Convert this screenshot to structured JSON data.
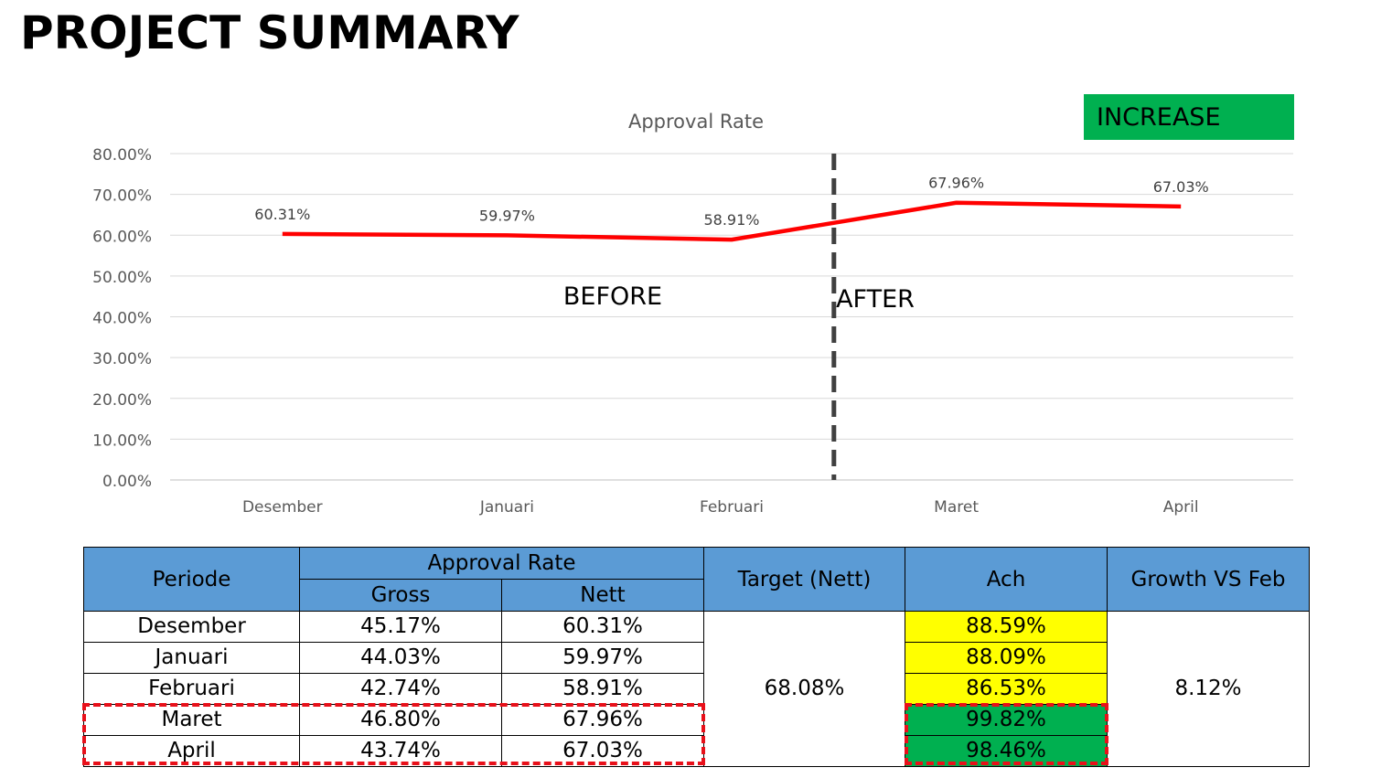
{
  "page": {
    "title": "PROJECT SUMMARY",
    "badge": "INCREASE",
    "annot_before": "BEFORE",
    "annot_after": "AFTER"
  },
  "colors": {
    "line": "#ff0000",
    "badge": "#00b050",
    "header": "#5b9bd5",
    "highlight_yellow": "#ffff00",
    "highlight_green": "#00b050",
    "dash_box": "#e8101a"
  },
  "chart_data": {
    "type": "line",
    "title": "Approval Rate",
    "categories": [
      "Desember",
      "Januari",
      "Februari",
      "Maret",
      "April"
    ],
    "series": [
      {
        "values": [
          60.31,
          59.97,
          58.91,
          67.96,
          67.03
        ]
      }
    ],
    "data_labels": [
      "60.31%",
      "59.97%",
      "58.91%",
      "67.96%",
      "67.03%"
    ],
    "yticks": [
      "0.00%",
      "10.00%",
      "20.00%",
      "30.00%",
      "40.00%",
      "50.00%",
      "60.00%",
      "70.00%",
      "80.00%"
    ],
    "ylim": [
      0,
      80
    ],
    "grid": true,
    "divider_after_category": "Februari"
  },
  "table": {
    "headers": {
      "periode": "Periode",
      "approval_rate": "Approval Rate",
      "gross": "Gross",
      "nett": "Nett",
      "target": "Target (Nett)",
      "ach": "Ach",
      "growth": "Growth VS Feb"
    },
    "rows": [
      {
        "periode": "Desember",
        "gross": "45.17%",
        "nett": "60.31%",
        "ach": "88.59%"
      },
      {
        "periode": "Januari",
        "gross": "44.03%",
        "nett": "59.97%",
        "ach": "88.09%"
      },
      {
        "periode": "Februari",
        "gross": "42.74%",
        "nett": "58.91%",
        "ach": "86.53%"
      },
      {
        "periode": "Maret",
        "gross": "46.80%",
        "nett": "67.96%",
        "ach": "99.82%"
      },
      {
        "periode": "April",
        "gross": "43.74%",
        "nett": "67.03%",
        "ach": "98.46%"
      }
    ],
    "target_value": "68.08%",
    "growth_value": "8.12%"
  }
}
